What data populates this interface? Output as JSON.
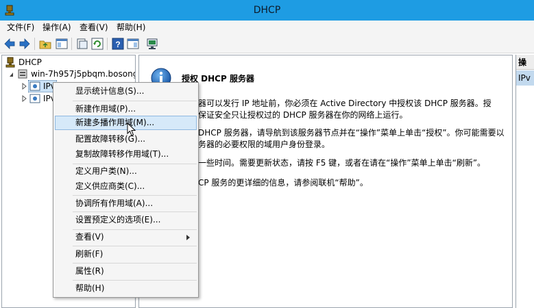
{
  "window": {
    "title": "DHCP"
  },
  "menubar": {
    "items": [
      "文件(F)",
      "操作(A)",
      "查看(V)",
      "帮助(H)"
    ]
  },
  "toolbar": {
    "buttons": [
      "back-icon",
      "forward-icon",
      "up-folder-icon",
      "show-hide-tree-icon",
      "export-list-icon",
      "refresh-icon",
      "help-icon",
      "properties-view-icon",
      "monitor-icon"
    ]
  },
  "tree": {
    "root": "DHCP",
    "server": "win-7h957j5pbqm.bosong.c",
    "ipv4": "IPv",
    "ipv6": "IPv"
  },
  "center": {
    "heading": "授权 DHCP 服务器",
    "lines": [
      "器可以发行 IP 地址前，你必须在 Active Directory 中授权该 DHCP  服务器。授",
      "保证安全只让授权过的 DHCP 服务器在你的网络上运行。",
      "DHCP 服务器，请导航到该服务器节点并在“操作”菜单上单击“授权”。你可能需要以",
      "务器的必要权限的域用户身份登录。",
      "一些时间。需要更新状态，请按 F5 键，或者在请在“操作”菜单上单击“刷新”。",
      "CP 服务的更详细的信息，请参阅联机“帮助”。"
    ]
  },
  "actions": {
    "header": "操",
    "item": "IPv"
  },
  "context_menu": {
    "items": [
      "显示统计信息(S)...",
      "新建作用域(P)...",
      "新建多播作用域(M)...",
      "配置故障转移(G)...",
      "复制故障转移作用域(T)...",
      "定义用户类(N)...",
      "定义供应商类(C)...",
      "协调所有作用域(A)...",
      "设置预定义的选项(E)...",
      "查看(V)",
      "刷新(F)",
      "属性(R)",
      "帮助(H)"
    ],
    "highlighted_index": 2
  },
  "colors": {
    "titlebar": "#1e9ce3",
    "highlight": "#d6e9f9"
  }
}
